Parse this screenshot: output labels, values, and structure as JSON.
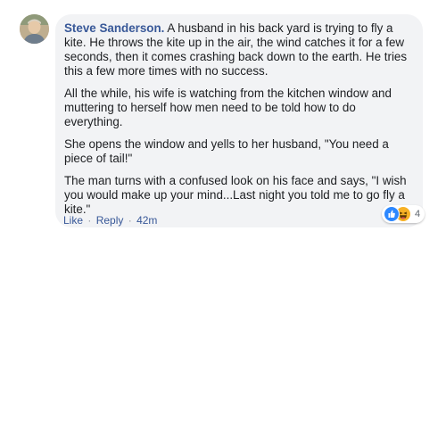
{
  "comment": {
    "author": "Steve Sanderson.",
    "paragraphs": [
      "A husband in his back yard is trying to fly a kite. He throws the kite up in the air, the wind catches it for a few seconds, then it comes crashing back down to the earth. He tries this a few more times with no success.",
      "All the while, his wife is watching from the kitchen window and muttering to herself how men need to be told how to do everything.",
      "She opens the window and yells to her husband, \"You need a piece of tail!\"",
      "The man turns with a confused look on his face and says, \"I wish you would make up your mind...Last night you told me to go fly a kite.\""
    ],
    "reactions": {
      "icons": [
        "like-icon",
        "haha-icon"
      ],
      "count": "4"
    },
    "actions": {
      "like_label": "Like",
      "reply_label": "Reply",
      "separator": "·",
      "timestamp": "42m"
    }
  },
  "colors": {
    "author_link": "#385898",
    "bubble_bg": "#f2f3f5",
    "like_blue": "#2d88ff",
    "haha_yellow": "#f7b125"
  }
}
